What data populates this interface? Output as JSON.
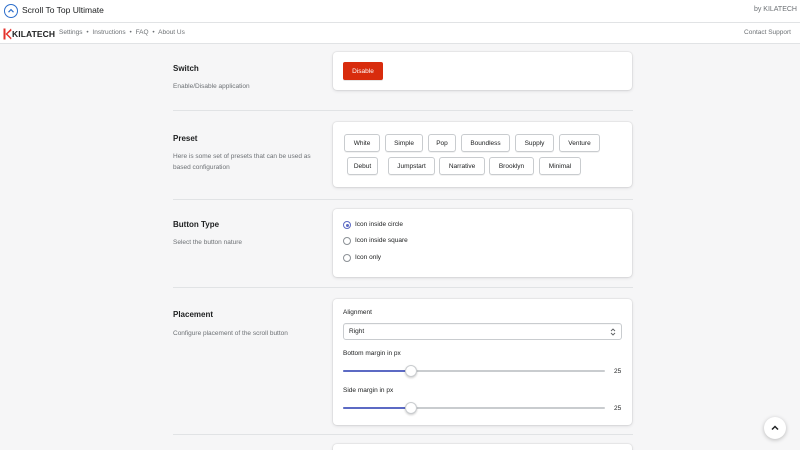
{
  "header": {
    "title": "Scroll To Top Ultimate",
    "by": "by KILATECH"
  },
  "nav": {
    "brand": "KILATECH",
    "links": [
      "Settings",
      "Instructions",
      "FAQ",
      "About Us"
    ],
    "separator": "•",
    "contact": "Contact Support"
  },
  "switch": {
    "title": "Switch",
    "description": "Enable/Disable application",
    "button_label": "Disable"
  },
  "preset": {
    "title": "Preset",
    "description": "Here is some set of presets that can be used as based configuration",
    "buttons": [
      "White",
      "Simple",
      "Pop",
      "Boundless",
      "Supply",
      "Venture",
      "Debut",
      "Jumpstart",
      "Narrative",
      "Brooklyn",
      "Minimal"
    ]
  },
  "button_type": {
    "title": "Button Type",
    "description": "Select the button nature",
    "options": [
      "Icon inside circle",
      "Icon inside square",
      "Icon only"
    ],
    "selected": 0
  },
  "placement": {
    "title": "Placement",
    "description": "Configure placement of the scroll button",
    "alignment_label": "Alignment",
    "alignment_value": "Right",
    "bottom_margin_label": "Bottom margin in px",
    "bottom_margin_value": "25",
    "bottom_margin_fraction": 0.26,
    "side_margin_label": "Side margin in px",
    "side_margin_value": "25",
    "side_margin_fraction": 0.26
  },
  "colors": {
    "accent": "#5c6ac4",
    "destructive": "#d82c0d",
    "app_icon": "#2c6ecb",
    "brand_red": "#e4322b"
  },
  "icons": {
    "app": "chevron-up-circle-icon",
    "brand": "kilatech-logo-icon",
    "select": "select-chevron-icon",
    "scroll_top": "chevron-up-icon"
  }
}
